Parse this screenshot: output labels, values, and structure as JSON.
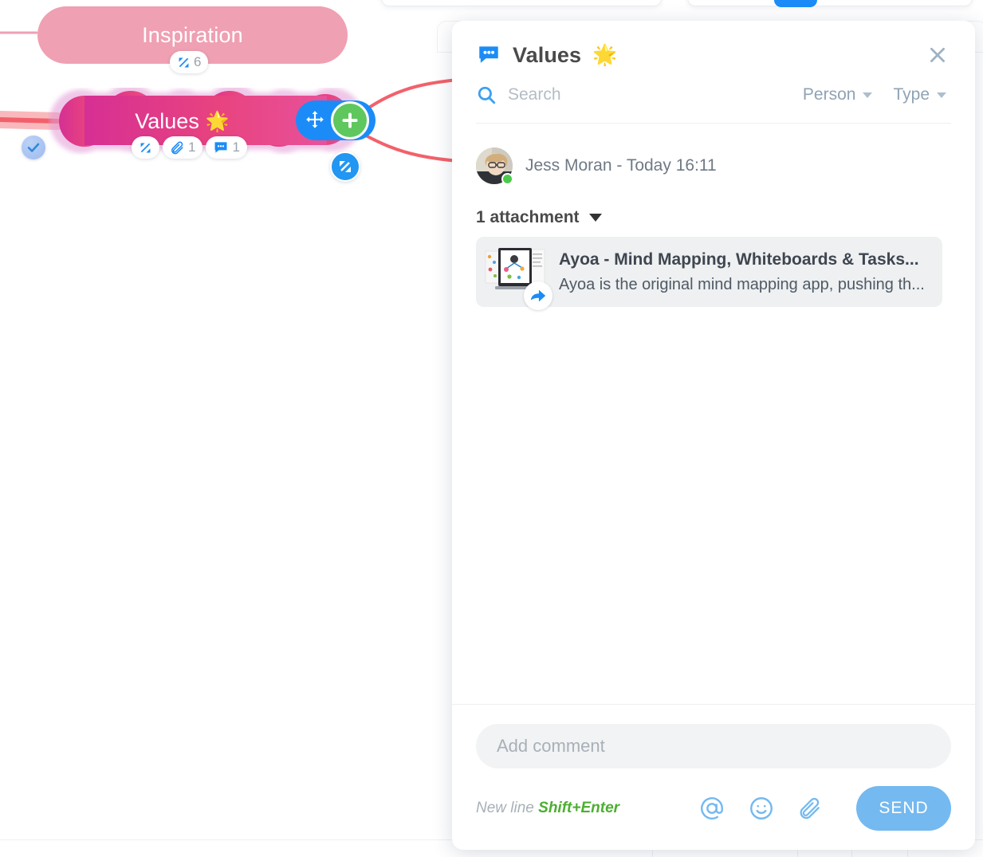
{
  "mindmap": {
    "nodes": [
      {
        "label": "Inspiration",
        "badge_count": "6",
        "badge_icon": "collapse-icon",
        "color": "#efa0b2"
      },
      {
        "label": "Values",
        "emoji": "🌟",
        "color": "#e0398c",
        "halo_color": "#e8a8d4",
        "badges": [
          {
            "icon": "collapse-icon",
            "count": ""
          },
          {
            "icon": "paperclip-icon",
            "count": "1"
          },
          {
            "icon": "comment-icon",
            "count": "1"
          }
        ],
        "check_badge_icon": "check-icon",
        "actions": {
          "drag_icon": "move-icon",
          "add_icon": "plus-icon",
          "expand_icon": "expand-icon"
        }
      }
    ],
    "connector_color": "#f2616b",
    "inspiration_connector_color": "#efa0b2"
  },
  "panel": {
    "header": {
      "icon": "comment-bubble-icon",
      "title": "Values",
      "emoji": "🌟",
      "close_icon": "close-icon"
    },
    "search": {
      "icon": "search-icon",
      "placeholder": "Search",
      "value": ""
    },
    "filters": [
      {
        "label": "Person",
        "icon": "chevron-down-icon"
      },
      {
        "label": "Type",
        "icon": "chevron-down-icon"
      }
    ],
    "message": {
      "author": "Jess Moran - Today 16:11",
      "status": "online",
      "attachments_label": "1 attachment",
      "attachments_caret": "caret-down-icon",
      "attachment": {
        "title": "Ayoa - Mind Mapping, Whiteboards & Tasks...",
        "description": "Ayoa is the original mind mapping app, pushing th...",
        "share_icon": "share-arrow-icon",
        "thumb": "mindmap-laptop-thumbnail"
      }
    },
    "footer": {
      "comment_placeholder": "Add comment",
      "comment_value": "",
      "hint_prefix": "New line ",
      "hint_shortcut": "Shift+Enter",
      "icons": [
        {
          "name": "mention-icon",
          "glyph": "@"
        },
        {
          "name": "emoji-icon",
          "glyph": "☺"
        },
        {
          "name": "attach-icon",
          "glyph": "📎"
        }
      ],
      "send_label": "SEND"
    }
  },
  "colors": {
    "accent_blue": "#1b8cf7",
    "send_blue": "#74b9f0",
    "green": "#5ec75e",
    "hint_green": "#4caf30",
    "pink_node": "#efa0b2",
    "magenta_node": "#e0398c",
    "connector_red": "#f2616b"
  }
}
